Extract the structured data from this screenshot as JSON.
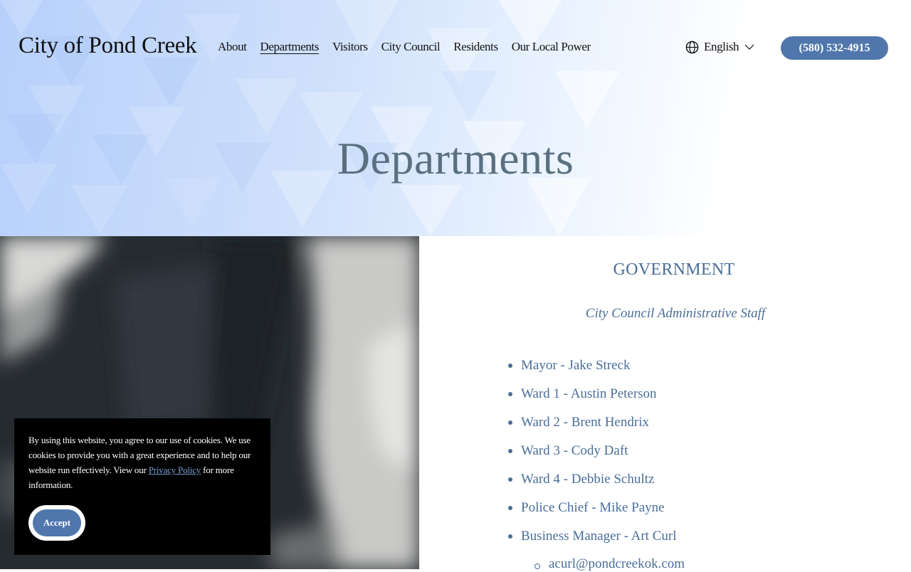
{
  "header": {
    "site_title": "City of Pond Creek",
    "nav": [
      {
        "label": "About",
        "active": false
      },
      {
        "label": "Departments",
        "active": true
      },
      {
        "label": "Visitors",
        "active": false
      },
      {
        "label": "City Council",
        "active": false
      },
      {
        "label": "Residents",
        "active": false
      },
      {
        "label": "Our Local Power",
        "active": false
      }
    ],
    "language": {
      "label": "English",
      "icon": "globe-icon",
      "chevron": "chevron-down-icon"
    },
    "phone_label": "(580) 532-4915",
    "accent_color": "#4f76ad"
  },
  "hero": {
    "heading": "Departments"
  },
  "government": {
    "title": "GOVERNMENT",
    "subtitle": "City Council Administrative Staff",
    "staff": [
      "Mayor - Jake Streck",
      "Ward 1 - Austin Peterson",
      "Ward 2 - Brent Hendrix",
      "Ward 3 - Cody Daft",
      "Ward 4 - Debbie Schultz",
      "Police Chief - Mike Payne",
      "Business Manager - Art Curl"
    ],
    "sub_item": "acurl@pondcreekok.com",
    "text_color": "#4a6e99"
  },
  "cookie_banner": {
    "text_before": "By using this website, you agree to our use of cookies. We use cookies to provide you with a great experience and to help our website run effectively.  View our ",
    "link_label": "Privacy Policy",
    "text_after": " for more information.",
    "accept_label": "Accept"
  }
}
